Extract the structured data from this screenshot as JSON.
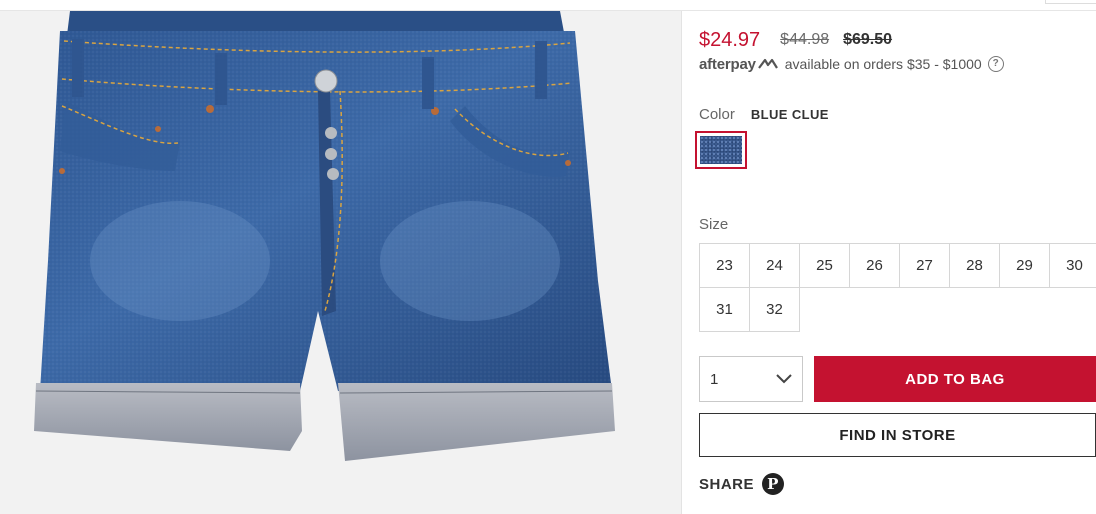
{
  "product": {
    "image_alt": "Denim shorts with cuffed hems",
    "price_sale": "$24.97",
    "price_was": "$44.98",
    "price_original": "$69.50"
  },
  "afterpay": {
    "logo": "afterpay",
    "text": "available on orders $35 - $1000",
    "help_icon": "?"
  },
  "color": {
    "label": "Color",
    "selected": "BLUE CLUE"
  },
  "size": {
    "label": "Size",
    "options": [
      "23",
      "24",
      "25",
      "26",
      "27",
      "28",
      "29",
      "30",
      "31",
      "32"
    ]
  },
  "quantity": {
    "value": "1"
  },
  "buttons": {
    "add_to_bag": "ADD TO BAG",
    "find_in_store": "FIND IN STORE"
  },
  "share": {
    "label": "SHARE",
    "pinterest_glyph": "P"
  },
  "colors": {
    "accent": "#c41230",
    "denim": "#3b5b8f"
  }
}
